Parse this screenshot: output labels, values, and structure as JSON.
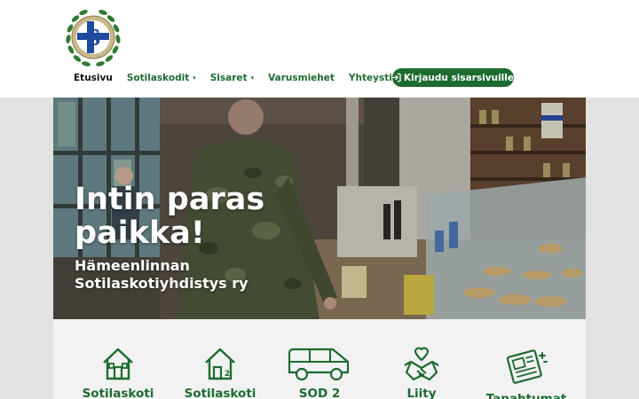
{
  "nav": {
    "items": [
      {
        "label": "Etusivu",
        "active": true,
        "dropdown": false
      },
      {
        "label": "Sotilaskodit",
        "active": false,
        "dropdown": true
      },
      {
        "label": "Sisaret",
        "active": false,
        "dropdown": true
      },
      {
        "label": "Varusmiehet",
        "active": false,
        "dropdown": false
      },
      {
        "label": "Yhteystiedot",
        "active": false,
        "dropdown": false
      }
    ],
    "login_label": "Kirjaudu sisarsivuille",
    "login_icon": "login-icon"
  },
  "hero": {
    "title": "Intin paras paikka!",
    "subtitle": "Hämeenlinnan Sotilaskotiyhdistys ry"
  },
  "services": [
    {
      "label": "Sotilaskoti",
      "icon": "house-icon"
    },
    {
      "label": "Sotilaskoti",
      "icon": "house-2-icon"
    },
    {
      "label": "SOD 2",
      "icon": "van-icon"
    },
    {
      "label": "Liity",
      "icon": "heart-hands-icon"
    },
    {
      "label": "Tapahtumat",
      "icon": "newspaper-icon"
    }
  ],
  "colors": {
    "brand": "#1d6b2f",
    "band": "#e2e2e2",
    "panel": "#f2f2f2"
  }
}
